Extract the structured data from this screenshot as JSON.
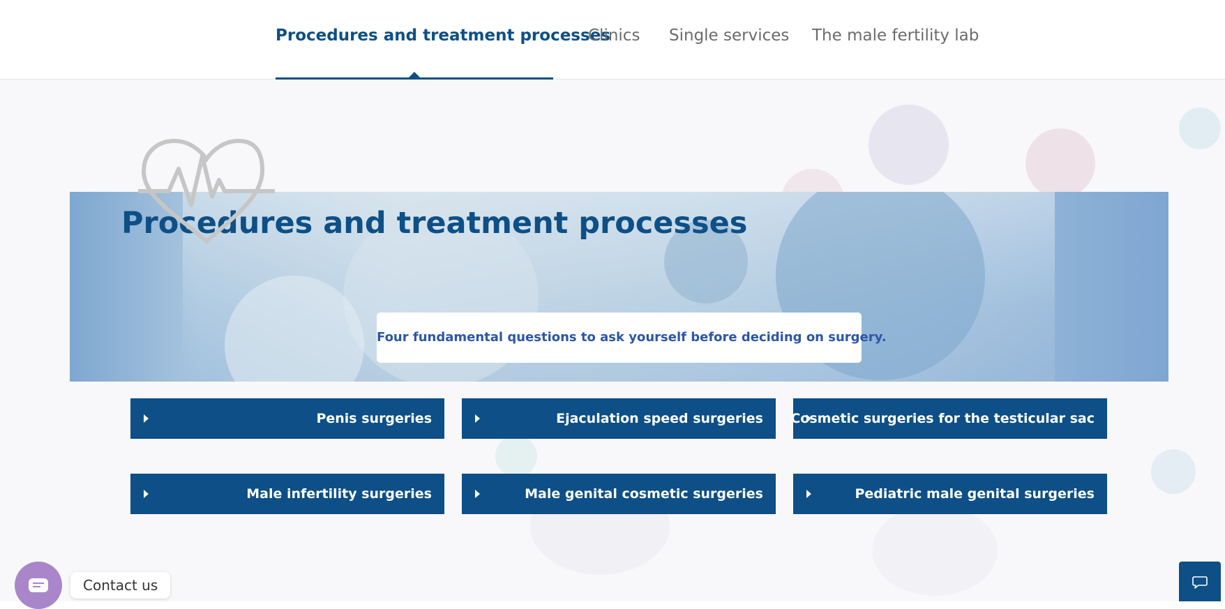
{
  "nav": {
    "tabs": [
      {
        "label": "Procedures and treatment processes",
        "active": true
      },
      {
        "label": "Clinics",
        "active": false
      },
      {
        "label": "Single services",
        "active": false
      },
      {
        "label": "The male fertility lab",
        "active": false
      }
    ]
  },
  "hero": {
    "title": "Procedures and treatment processes",
    "questions_link": "Four fundamental questions to ask yourself before deciding on surgery."
  },
  "categories": [
    {
      "label": "Penis surgeries"
    },
    {
      "label": "Ejaculation speed surgeries"
    },
    {
      "label": "Cosmetic surgeries for the testicular sac"
    },
    {
      "label": "Male infertility surgeries"
    },
    {
      "label": "Male genital cosmetic surgeries"
    },
    {
      "label": "Pediatric male genital surgeries"
    }
  ],
  "contact": {
    "label": "Contact us"
  },
  "colors": {
    "brand_blue": "#0d4f86",
    "link_blue": "#2c56a6",
    "contact_purple": "#a986c9"
  },
  "icons": {
    "heart": "heartbeat-icon",
    "caret": "caret-right-icon",
    "message": "message-icon",
    "chat": "chat-bubble-icon"
  }
}
